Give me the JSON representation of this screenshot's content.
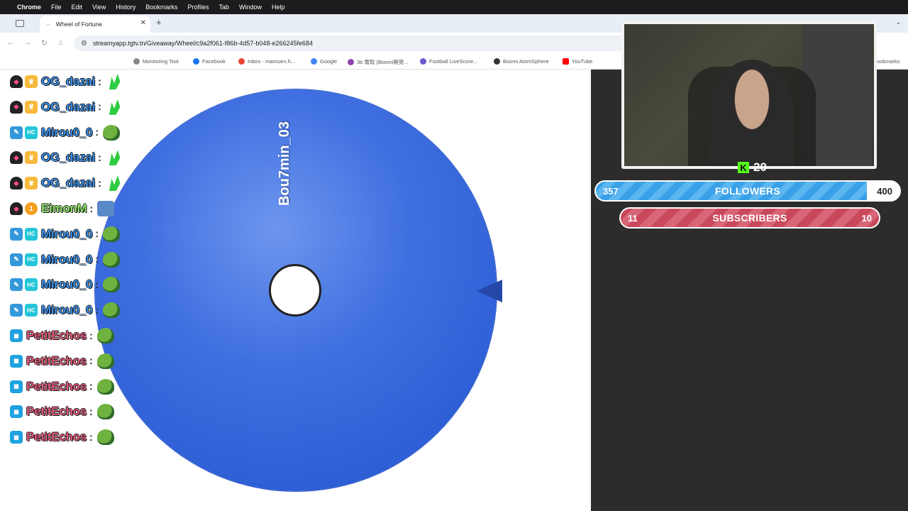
{
  "menubar": {
    "app": "Chrome",
    "items": [
      "File",
      "Edit",
      "View",
      "History",
      "Bookmarks",
      "Profiles",
      "Tab",
      "Window",
      "Help"
    ]
  },
  "tab": {
    "title": "Wheel of Fortune"
  },
  "address": {
    "url": "streamyapp.tgtv.tn/Giveaway/Wheel/c9a2f061-f86b-4d57-b048-e266245fe684"
  },
  "bookmarks": {
    "items": [
      "Monitoring Tool",
      "Facebook",
      "Inbox - marouen.h...",
      "Google",
      "3b 電取 (Boomi開発...",
      "Football LiveScore...",
      "Boomi AtomSphere",
      "YouTube"
    ],
    "all_label": "ookmarks"
  },
  "chat": {
    "messages": [
      {
        "user": "OG_dazai",
        "color": "blue",
        "badges": [
          "shield",
          "crown"
        ],
        "emote": "leaf"
      },
      {
        "user": "OG_dazai",
        "color": "blue",
        "badges": [
          "shield",
          "crown"
        ],
        "emote": "leaf"
      },
      {
        "user": "Mirou0_0",
        "color": "blue",
        "badges": [
          "pen",
          "hc"
        ],
        "emote": "frog"
      },
      {
        "user": "OG_dazai",
        "color": "blue",
        "badges": [
          "shield",
          "crown"
        ],
        "emote": "leaf"
      },
      {
        "user": "OG_dazai",
        "color": "blue",
        "badges": [
          "shield",
          "crown"
        ],
        "emote": "leaf"
      },
      {
        "user": "EimonM",
        "color": "green",
        "badges": [
          "shield",
          "num"
        ],
        "emote": "blue"
      },
      {
        "user": "Mirou0_0",
        "color": "blue",
        "badges": [
          "pen",
          "hc"
        ],
        "emote": "frog"
      },
      {
        "user": "Mirou0_0",
        "color": "blue",
        "badges": [
          "pen",
          "hc"
        ],
        "emote": "frog"
      },
      {
        "user": "Mirou0_0",
        "color": "blue",
        "badges": [
          "pen",
          "hc"
        ],
        "emote": "frog"
      },
      {
        "user": "Mirou0_0",
        "color": "blue",
        "badges": [
          "pen",
          "hc"
        ],
        "emote": "frog"
      },
      {
        "user": "PetitEchos",
        "color": "pink",
        "badges": [
          "cube"
        ],
        "emote": "frog"
      },
      {
        "user": "PetitEchos",
        "color": "pink",
        "badges": [
          "cube"
        ],
        "emote": "frog"
      },
      {
        "user": "PetitEchos",
        "color": "pink",
        "badges": [
          "cube"
        ],
        "emote": "frog"
      },
      {
        "user": "PetitEchos",
        "color": "pink",
        "badges": [
          "cube"
        ],
        "emote": "frog"
      },
      {
        "user": "PetitEchos",
        "color": "pink",
        "badges": [
          "cube"
        ],
        "emote": "frog"
      }
    ],
    "separator": ":"
  },
  "wheel": {
    "segment_label": "Bou7min_03",
    "color": "#3f6fe0"
  },
  "stream": {
    "kick_viewers": "20",
    "followers": {
      "current": "357",
      "label": "FOLLOWERS",
      "goal": "400",
      "progress": 0.8925
    },
    "subscribers": {
      "current": "11",
      "label": "SUBSCRIBERS",
      "goal": "10"
    }
  }
}
